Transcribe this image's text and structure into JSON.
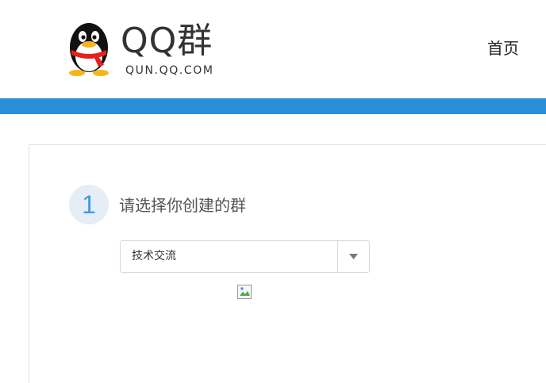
{
  "header": {
    "logo_title": "QQ群",
    "logo_subtitle": "QUN.QQ.COM",
    "nav_home": "首页"
  },
  "colors": {
    "accent_bar": "#2a8fd7",
    "step_number": "#3f9be0"
  },
  "step": {
    "number": "1",
    "title": "请选择你创建的群"
  },
  "group_select": {
    "selected_value": "技术交流",
    "arrow_icon": "triangle-down-icon"
  },
  "image": {
    "icon": "broken-image-icon"
  }
}
